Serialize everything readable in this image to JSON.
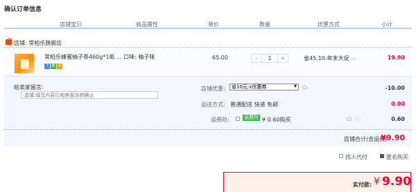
{
  "section_title": "确认订单信息",
  "columns": [
    "店铺宝贝",
    "商品属性",
    "单价",
    "数量",
    "优惠方式",
    "小计"
  ],
  "store": {
    "label": "店铺: 常柏乐旗舰店"
  },
  "item": {
    "name": "常柏乐蜂蜜柚子茶460g*1瓶 ... 口味: 柚子味",
    "badges": [
      "7",
      "卖",
      "卡"
    ],
    "unit_price": "65.00",
    "quantity": "1",
    "qty_minus": "-",
    "qty_plus": "+",
    "promotion": "省45.10:年末大促",
    "subtotal": "19.90"
  },
  "message": {
    "label": "给卖家留言:",
    "placeholder": "选填:填写内容已和卖家协商确认"
  },
  "store_discount": {
    "label": "店铺优惠:",
    "selected": "省10元:x优惠券",
    "amount": "-10.00"
  },
  "shipping": {
    "label": "运送方式:",
    "value": "普通配送 快递 免邮",
    "amount": "0.00"
  },
  "insurance": {
    "label": "运费险:",
    "badge": "运费险",
    "value": "¥ 0.60购买",
    "amount": "0.60"
  },
  "store_total": {
    "label": "店铺合计(含运费)",
    "value": "¥9.90"
  },
  "options": {
    "proxy_pay": "找人代付",
    "anonymous": "匿名购买"
  },
  "payment": {
    "label": "实付款:",
    "currency": "¥",
    "value": "9.90"
  },
  "colors": {
    "accent": "#ff0036",
    "header_line": "#b2d1ff",
    "panel_bg": "#f2f7ff",
    "badge_green": "#3ab54a"
  }
}
